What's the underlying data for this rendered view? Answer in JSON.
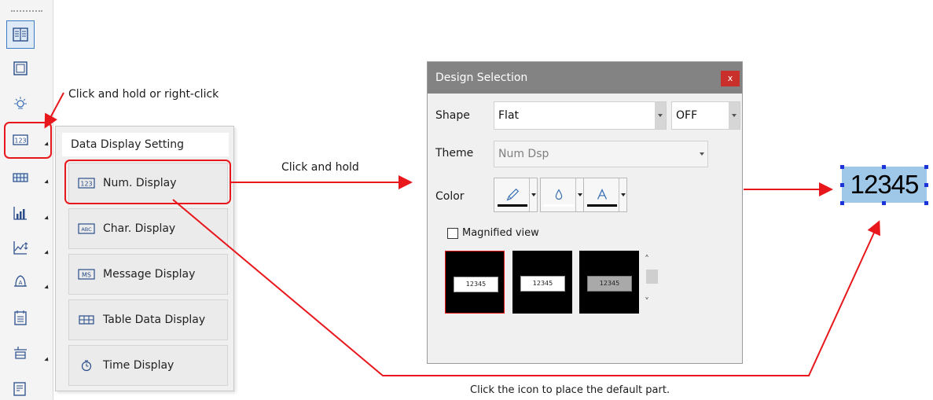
{
  "toolbar": {
    "buttons": [
      {
        "icon": "screen-library-icon",
        "selected": true,
        "has_arrow": false
      },
      {
        "icon": "window-icon",
        "selected": false,
        "has_arrow": false
      },
      {
        "icon": "lamp-icon",
        "selected": false,
        "has_arrow": false
      },
      {
        "icon": "data-display-icon",
        "selected": false,
        "has_arrow": true
      },
      {
        "icon": "keypad-icon",
        "selected": false,
        "has_arrow": true
      },
      {
        "icon": "bar-graph-icon",
        "selected": false,
        "has_arrow": true
      },
      {
        "icon": "trend-graph-icon",
        "selected": false,
        "has_arrow": true
      },
      {
        "icon": "alarm-icon",
        "selected": false,
        "has_arrow": true
      },
      {
        "icon": "calendar-icon",
        "selected": false,
        "has_arrow": false
      },
      {
        "icon": "sampling-icon",
        "selected": false,
        "has_arrow": true
      },
      {
        "icon": "report-icon",
        "selected": false,
        "has_arrow": true
      }
    ]
  },
  "popup": {
    "title": "Data Display Setting",
    "items": [
      {
        "label": "Num. Display",
        "icon": "num-display-icon"
      },
      {
        "label": "Char. Display",
        "icon": "char-display-icon"
      },
      {
        "label": "Message Display",
        "icon": "message-display-icon"
      },
      {
        "label": "Table Data Display",
        "icon": "table-data-display-icon"
      },
      {
        "label": "Time Display",
        "icon": "time-display-icon"
      }
    ]
  },
  "annotations": {
    "right_click": "Click and hold or right-click",
    "click_and_hold": "Click and hold",
    "place_default": "Click the icon to place the default part."
  },
  "dialog": {
    "title": "Design Selection",
    "close": "x",
    "shape_label": "Shape",
    "shape_value": "Flat",
    "shape_option_value": "OFF",
    "theme_label": "Theme",
    "theme_value": "Num Dsp",
    "color_label": "Color",
    "color_buttons": [
      {
        "icon": "pen-icon",
        "bar_color": "#000000"
      },
      {
        "icon": "fill-icon",
        "bar_color": "#ffffff"
      },
      {
        "icon": "font-color-icon",
        "bar_color": "#000000"
      }
    ],
    "magnified_label": "Magnified view",
    "magnified_checked": false,
    "thumbnails": [
      {
        "text": "12345",
        "selected": true,
        "inner_bg": "#ffffff"
      },
      {
        "text": "12345",
        "selected": false,
        "inner_bg": "#ffffff"
      },
      {
        "text": "12345",
        "selected": false,
        "inner_bg": "#a9a9a9"
      }
    ]
  },
  "result_part": {
    "text": "12345",
    "background": "#9fc7e8"
  },
  "colors": {
    "highlight": "#e8171c",
    "titlebar": "#838383",
    "close": "#c9302c",
    "selection_handle": "#1a34d8"
  }
}
